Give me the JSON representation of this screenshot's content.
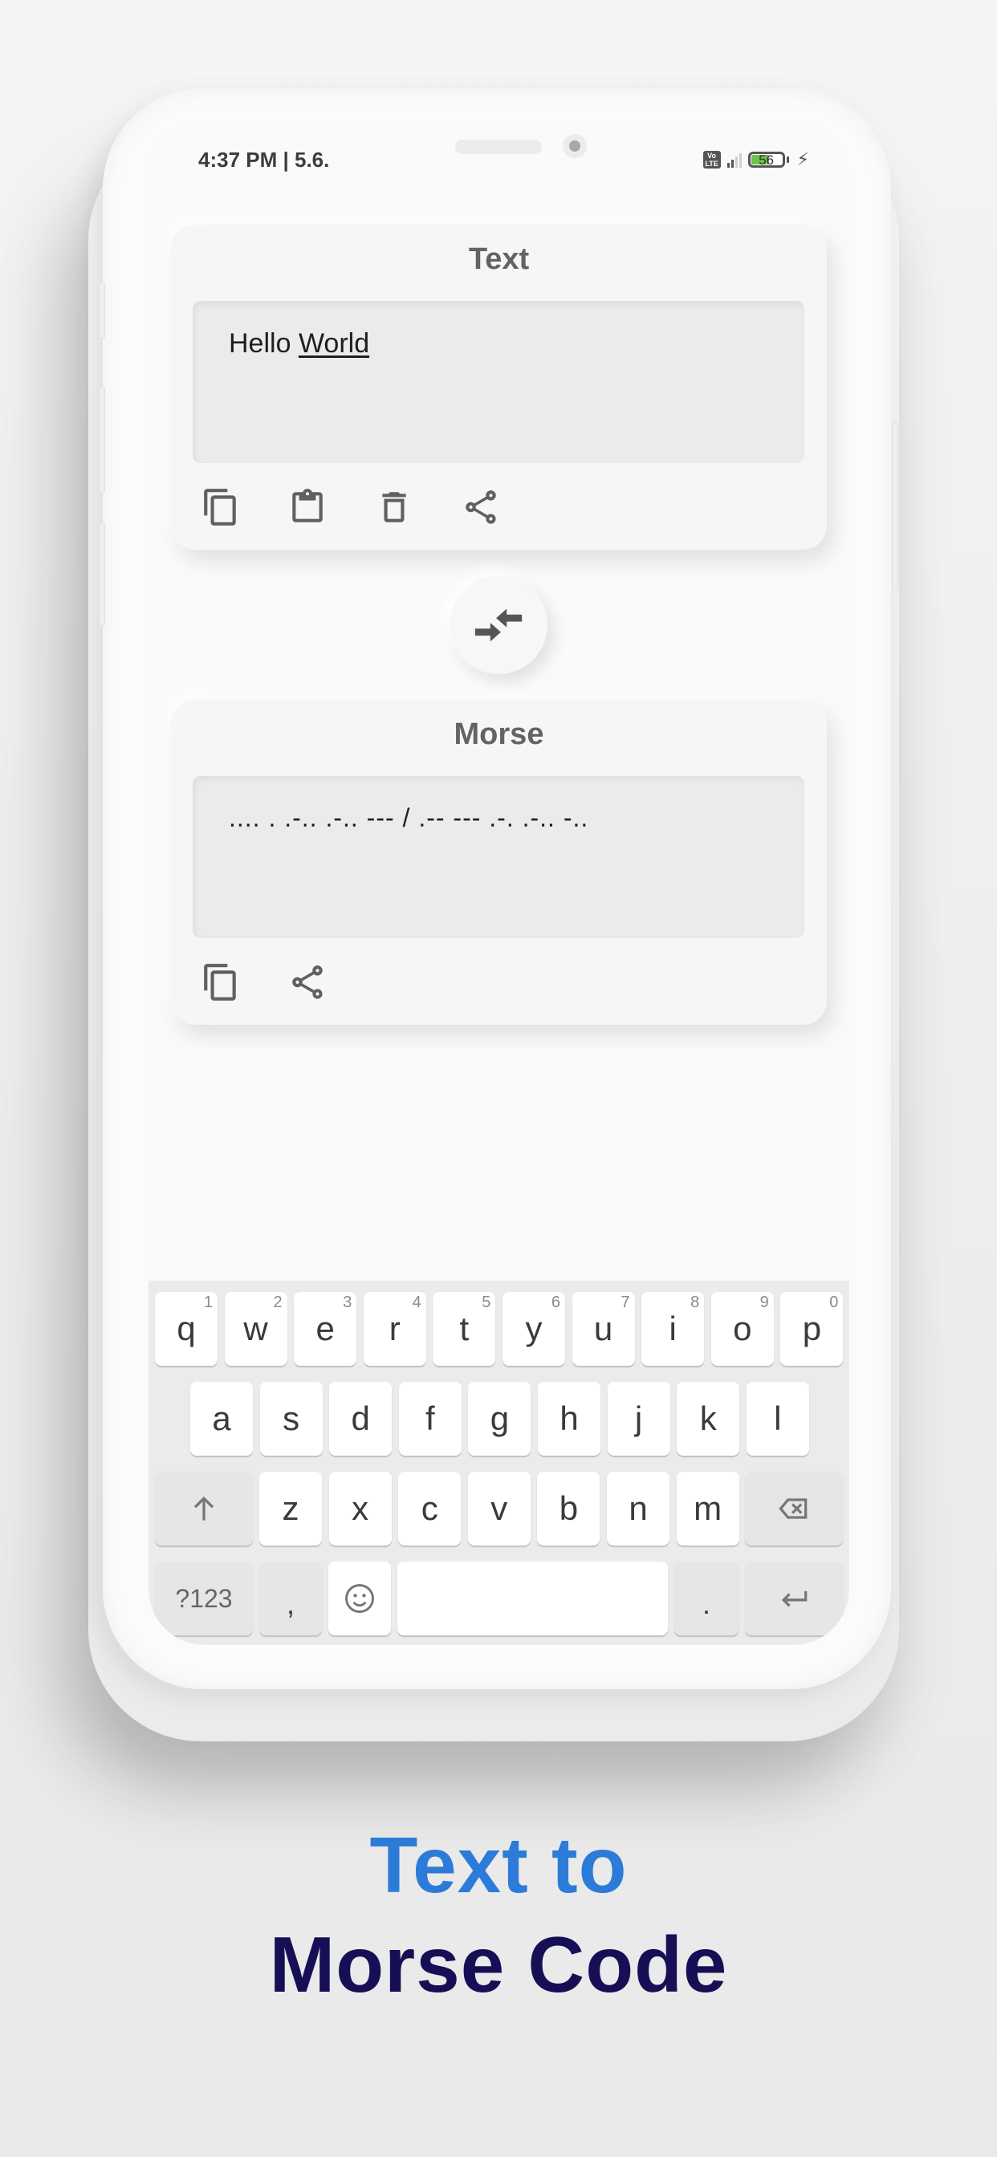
{
  "status_bar": {
    "time": "4:37 PM | 5.6.",
    "network_badge": "Vo LTE",
    "battery_level": "56",
    "icons": [
      "volte-icon",
      "signal-icon",
      "battery-icon",
      "charging-bolt-icon"
    ]
  },
  "text_card": {
    "title": "Text",
    "input_value_plain": "Hello ",
    "input_value_underlined": "World",
    "actions": [
      {
        "name": "copy",
        "icon": "copy-icon"
      },
      {
        "name": "paste",
        "icon": "clipboard-icon"
      },
      {
        "name": "clear",
        "icon": "trash-icon"
      },
      {
        "name": "share",
        "icon": "share-icon"
      }
    ]
  },
  "swap_button": {
    "icon": "swap-arrows-icon"
  },
  "morse_card": {
    "title": "Morse",
    "output_value": ".... . .-.. .-.. --- / .-- --- .-. .-.. -..",
    "actions": [
      {
        "name": "copy",
        "icon": "copy-icon"
      },
      {
        "name": "share",
        "icon": "share-icon"
      }
    ]
  },
  "keyboard": {
    "row1": [
      {
        "key": "q",
        "hint": "1"
      },
      {
        "key": "w",
        "hint": "2"
      },
      {
        "key": "e",
        "hint": "3"
      },
      {
        "key": "r",
        "hint": "4"
      },
      {
        "key": "t",
        "hint": "5"
      },
      {
        "key": "y",
        "hint": "6"
      },
      {
        "key": "u",
        "hint": "7"
      },
      {
        "key": "i",
        "hint": "8"
      },
      {
        "key": "o",
        "hint": "9"
      },
      {
        "key": "p",
        "hint": "0"
      }
    ],
    "row2": [
      "a",
      "s",
      "d",
      "f",
      "g",
      "h",
      "j",
      "k",
      "l"
    ],
    "row3": [
      "z",
      "x",
      "c",
      "v",
      "b",
      "n",
      "m"
    ],
    "symbols_label": "?123",
    "comma": ",",
    "period": ".",
    "space": ""
  },
  "caption": {
    "line1": "Text to",
    "line2": "Morse Code",
    "line1_color": "#2d7bd8",
    "line2_color": "#170f55"
  }
}
